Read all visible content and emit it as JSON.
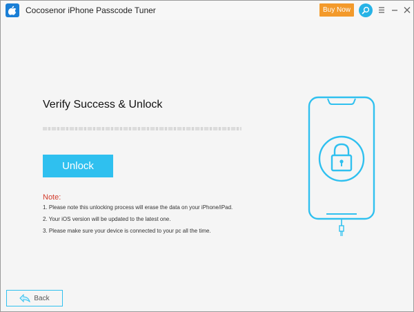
{
  "window": {
    "app_title": "Cocosenor iPhone Passcode Tuner",
    "buy_label": "Buy Now",
    "icons": {
      "app": "apple-logo-icon",
      "search": "search-icon",
      "menu": "hamburger-menu-icon",
      "minimize": "minimize-icon",
      "close": "close-icon"
    },
    "colors": {
      "buy_button": "#f39a2b",
      "accent": "#2fc0ef",
      "note": "#d23a2a"
    }
  },
  "main": {
    "heading": "Verify Success & Unlock",
    "progress_fraction": 1.0,
    "unlock_label": "Unlock",
    "note_title": "Note:",
    "notes": [
      "1. Please note this unlocking process will erase the data on your iPhone/iPad.",
      "2. Your iOS version will be updated to the latest one.",
      "3. Please make sure your device is connected to your pc all the time."
    ],
    "illustration": "phone-with-lock-icon"
  },
  "footer": {
    "back_label": "Back",
    "back_icon": "back-arrow-icon"
  }
}
